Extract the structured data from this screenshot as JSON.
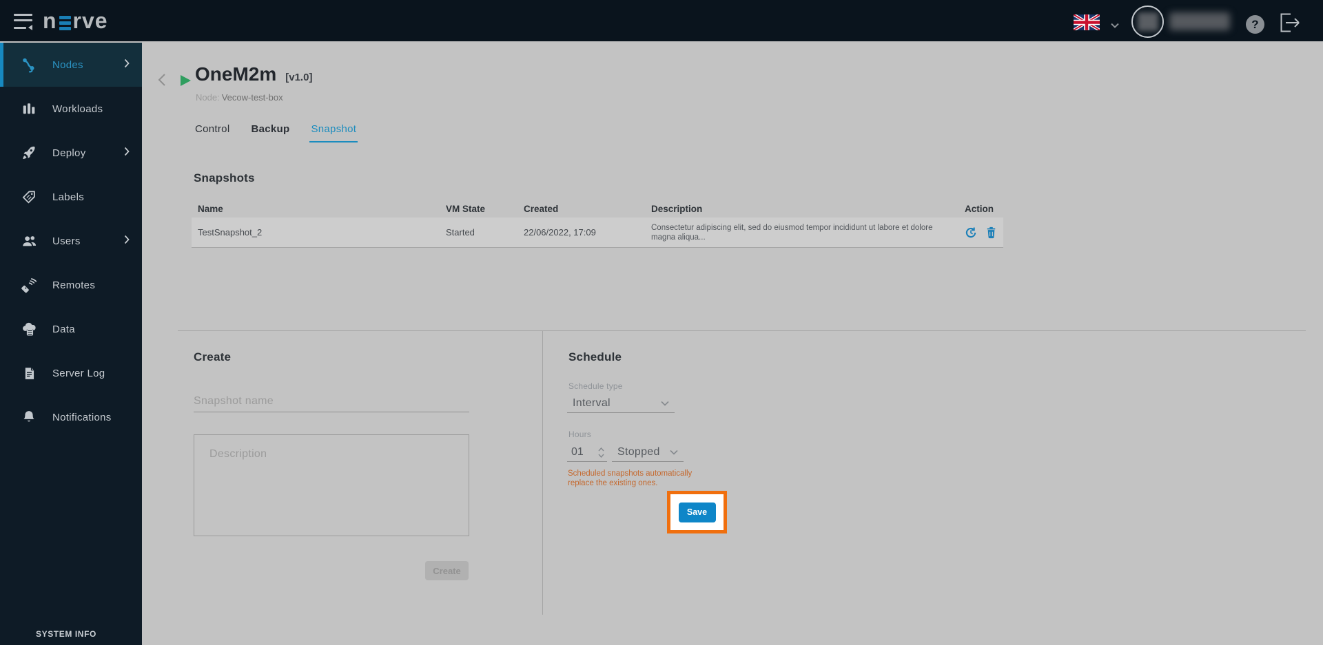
{
  "header": {
    "logo_first": "n",
    "logo_rest": "rve",
    "help_glyph": "?",
    "language_flag": "uk-flag"
  },
  "sidebar": {
    "items": [
      {
        "label": "Nodes",
        "icon": "nodes-icon",
        "active": true,
        "expandable": true
      },
      {
        "label": "Workloads",
        "icon": "workloads-icon",
        "active": false,
        "expandable": false
      },
      {
        "label": "Deploy",
        "icon": "deploy-icon",
        "active": false,
        "expandable": true
      },
      {
        "label": "Labels",
        "icon": "labels-icon",
        "active": false,
        "expandable": false
      },
      {
        "label": "Users",
        "icon": "users-icon",
        "active": false,
        "expandable": true
      },
      {
        "label": "Remotes",
        "icon": "remotes-icon",
        "active": false,
        "expandable": false
      },
      {
        "label": "Data",
        "icon": "data-icon",
        "active": false,
        "expandable": false
      },
      {
        "label": "Server Log",
        "icon": "server-log-icon",
        "active": false,
        "expandable": false
      },
      {
        "label": "Notifications",
        "icon": "notifications-icon",
        "active": false,
        "expandable": false
      }
    ],
    "footer": "SYSTEM INFO"
  },
  "page": {
    "title": "OneM2m",
    "version": "[v1.0]",
    "node_label": "Node:",
    "node_name": "Vecow-test-box",
    "status": "started"
  },
  "tabs": [
    {
      "label": "Control",
      "active": false
    },
    {
      "label": "Backup",
      "active": false
    },
    {
      "label": "Snapshot",
      "active": true
    }
  ],
  "snapshots": {
    "heading": "Snapshots",
    "columns": [
      "Name",
      "VM State",
      "Created",
      "Description",
      "Action"
    ],
    "rows": [
      {
        "name": "TestSnapshot_2",
        "vm_state": "Started",
        "created": "22/06/2022, 17:09",
        "description": "Consectetur adipiscing elit, sed do eiusmod tempor incididunt ut labore et dolore magna aliqua...",
        "actions": [
          "restore-icon",
          "delete-icon"
        ]
      }
    ]
  },
  "create": {
    "heading": "Create",
    "name_placeholder": "Snapshot name",
    "description_placeholder": "Description",
    "submit_label": "Create",
    "submit_disabled": true
  },
  "schedule": {
    "heading": "Schedule",
    "type_label": "Schedule type",
    "type_value": "Interval",
    "hours_label": "Hours",
    "hours_value": "01",
    "state_value": "Stopped",
    "warning": "Scheduled snapshots automatically replace the existing ones.",
    "save_label": "Save"
  },
  "colors": {
    "accent_blue": "#1789c0",
    "active_tab_blue": "#1b8cbe",
    "save_button_blue": "#0e86c8",
    "highlight_orange": "#f06f0e",
    "warning_orange": "#c4682d",
    "status_green": "#2f9e5f",
    "header_bg": "#0a141d",
    "sidebar_bg": "#0e1b26"
  }
}
